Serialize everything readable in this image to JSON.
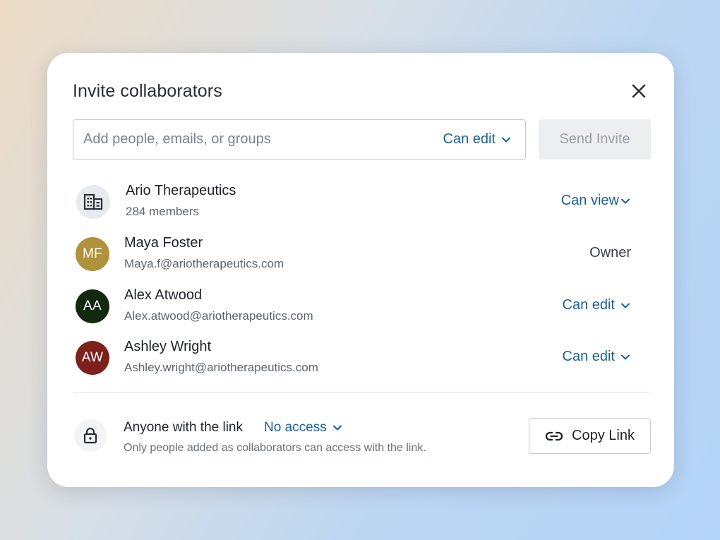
{
  "dialog": {
    "title": "Invite collaborators"
  },
  "invite": {
    "placeholder": "Add people, emails, or groups",
    "value": "",
    "permission": "Can edit",
    "send_label": "Send Invite"
  },
  "members": [
    {
      "name": "Ario Therapeutics",
      "subtitle": "284 members",
      "initials": "",
      "avatar_icon": "building-icon",
      "avatar_color": "#e7eaee",
      "permission": "Can view",
      "editable": true
    },
    {
      "name": "Maya Foster",
      "subtitle": "Maya.f@ariotherapeutics.com",
      "initials": "MF",
      "avatar_color": "#b0913c",
      "permission": "Owner",
      "editable": false
    },
    {
      "name": "Alex Atwood",
      "subtitle": "Alex.atwood@ariotherapeutics.com",
      "initials": "AA",
      "avatar_color": "#13290f",
      "permission": "Can edit",
      "editable": true
    },
    {
      "name": "Ashley Wright",
      "subtitle": "Ashley.wright@ariotherapeutics.com",
      "initials": "AW",
      "avatar_color": "#7e201b",
      "permission": "Can edit",
      "editable": true
    }
  ],
  "link_sharing": {
    "title": "Anyone with the link",
    "access": "No access",
    "description": "Only people added as collaborators can access with the link.",
    "copy_label": "Copy Link",
    "icon": "lock-icon"
  },
  "colors": {
    "accent": "#1c5f98",
    "text": "#1f2227",
    "muted": "#5e646c",
    "disabled_bg": "#eceef0"
  }
}
